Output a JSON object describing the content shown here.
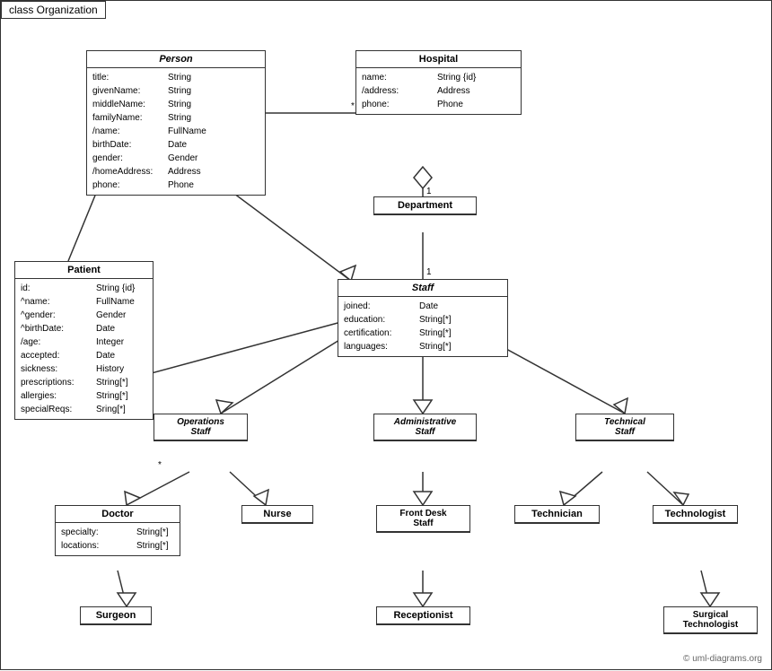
{
  "title": "class Organization",
  "classes": {
    "person": {
      "name": "Person",
      "italic": true,
      "attrs": [
        [
          "title:",
          "String"
        ],
        [
          "givenName:",
          "String"
        ],
        [
          "middleName:",
          "String"
        ],
        [
          "familyName:",
          "String"
        ],
        [
          "/name:",
          "FullName"
        ],
        [
          "birthDate:",
          "Date"
        ],
        [
          "gender:",
          "Gender"
        ],
        [
          "/homeAddress:",
          "Address"
        ],
        [
          "phone:",
          "Phone"
        ]
      ]
    },
    "hospital": {
      "name": "Hospital",
      "italic": false,
      "attrs": [
        [
          "name:",
          "String {id}"
        ],
        [
          "/address:",
          "Address"
        ],
        [
          "phone:",
          "Phone"
        ]
      ]
    },
    "department": {
      "name": "Department",
      "italic": false,
      "attrs": []
    },
    "staff": {
      "name": "Staff",
      "italic": true,
      "attrs": [
        [
          "joined:",
          "Date"
        ],
        [
          "education:",
          "String[*]"
        ],
        [
          "certification:",
          "String[*]"
        ],
        [
          "languages:",
          "String[*]"
        ]
      ]
    },
    "patient": {
      "name": "Patient",
      "italic": false,
      "attrs": [
        [
          "id:",
          "String {id}"
        ],
        [
          "^name:",
          "FullName"
        ],
        [
          "^gender:",
          "Gender"
        ],
        [
          "^birthDate:",
          "Date"
        ],
        [
          "/age:",
          "Integer"
        ],
        [
          "accepted:",
          "Date"
        ],
        [
          "sickness:",
          "History"
        ],
        [
          "prescriptions:",
          "String[*]"
        ],
        [
          "allergies:",
          "String[*]"
        ],
        [
          "specialReqs:",
          "Sring[*]"
        ]
      ]
    },
    "operations_staff": {
      "name": "Operations Staff",
      "italic": true,
      "attrs": []
    },
    "administrative_staff": {
      "name": "Administrative Staff",
      "italic": true,
      "attrs": []
    },
    "technical_staff": {
      "name": "Technical Staff",
      "italic": true,
      "attrs": []
    },
    "doctor": {
      "name": "Doctor",
      "italic": false,
      "attrs": [
        [
          "specialty:",
          "String[*]"
        ],
        [
          "locations:",
          "String[*]"
        ]
      ]
    },
    "nurse": {
      "name": "Nurse",
      "italic": false,
      "attrs": []
    },
    "front_desk_staff": {
      "name": "Front Desk Staff",
      "italic": false,
      "attrs": []
    },
    "technician": {
      "name": "Technician",
      "italic": false,
      "attrs": []
    },
    "technologist": {
      "name": "Technologist",
      "italic": false,
      "attrs": []
    },
    "surgeon": {
      "name": "Surgeon",
      "italic": false,
      "attrs": []
    },
    "receptionist": {
      "name": "Receptionist",
      "italic": false,
      "attrs": []
    },
    "surgical_technologist": {
      "name": "Surgical Technologist",
      "italic": false,
      "attrs": []
    }
  },
  "copyright": "© uml-diagrams.org"
}
